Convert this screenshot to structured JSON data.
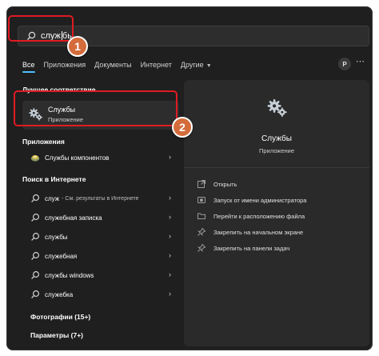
{
  "search": {
    "value": "служ",
    "value_after_caret": "бы"
  },
  "callouts": {
    "first": "1",
    "second": "2"
  },
  "tabs": {
    "all": "Все",
    "apps": "Приложения",
    "documents": "Документы",
    "internet": "Интернет",
    "other": "Другие"
  },
  "account": {
    "initial": "P"
  },
  "sections": {
    "best_match": "Лучшее соответствие",
    "apps": "Приложения",
    "web": "Поиск в Интернете",
    "photos": "Фотографии (15+)",
    "settings": "Параметры (7+)"
  },
  "best_match": {
    "title": "Службы",
    "subtitle": "Приложение"
  },
  "apps_items": [
    {
      "label": "Службы компонентов"
    }
  ],
  "web_items": [
    {
      "label": "служ",
      "sub": "- См. результаты в Интернете"
    },
    {
      "label": "служебная записка",
      "sub": ""
    },
    {
      "label": "службы",
      "sub": ""
    },
    {
      "label": "служебная",
      "sub": ""
    },
    {
      "label": "службы windows",
      "sub": ""
    },
    {
      "label": "служебка",
      "sub": ""
    }
  ],
  "panel": {
    "title": "Службы",
    "subtitle": "Приложение",
    "actions": [
      {
        "label": "Открыть",
        "icon": "open-icon"
      },
      {
        "label": "Запуск от имени администратора",
        "icon": "run-as-admin-icon"
      },
      {
        "label": "Перейти к расположению файла",
        "icon": "folder-icon"
      },
      {
        "label": "Закрепить на начальном экране",
        "icon": "pin-icon"
      },
      {
        "label": "Закрепить на панели задач",
        "icon": "pin-icon"
      }
    ]
  },
  "colors": {
    "window_bg": "#1f1f1f",
    "panel_bg": "#2a2a2a",
    "accent": "#4cc2ff",
    "highlight": "#e11b22",
    "callout": "#d46b3b"
  }
}
